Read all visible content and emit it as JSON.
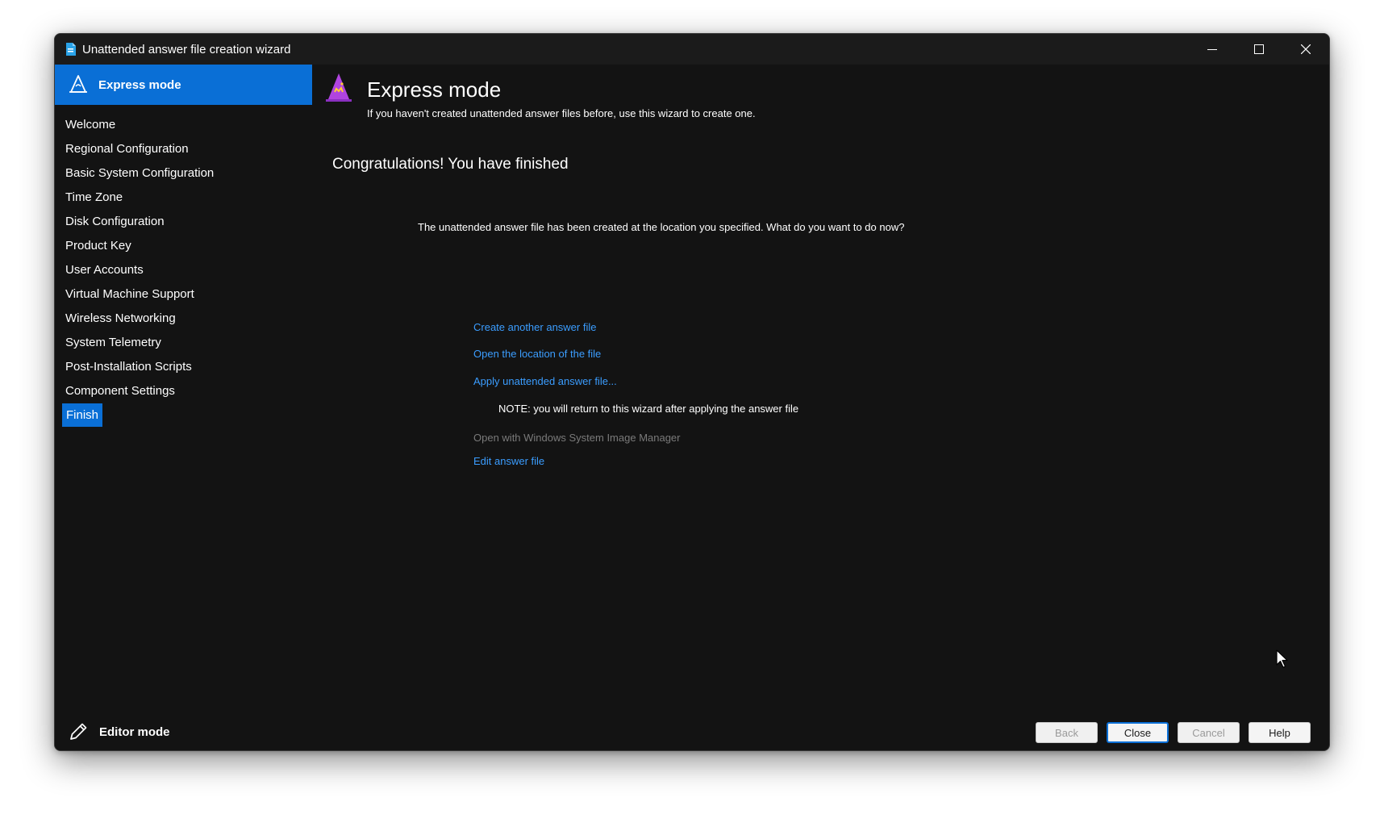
{
  "window": {
    "title": "Unattended answer file creation wizard"
  },
  "sidebar": {
    "header_label": "Express mode",
    "items": [
      {
        "label": "Welcome"
      },
      {
        "label": "Regional Configuration"
      },
      {
        "label": "Basic System Configuration"
      },
      {
        "label": "Time Zone"
      },
      {
        "label": "Disk Configuration"
      },
      {
        "label": "Product Key"
      },
      {
        "label": "User Accounts"
      },
      {
        "label": "Virtual Machine Support"
      },
      {
        "label": "Wireless Networking"
      },
      {
        "label": "System Telemetry"
      },
      {
        "label": "Post-Installation Scripts"
      },
      {
        "label": "Component Settings"
      },
      {
        "label": "Finish"
      }
    ],
    "active_item": "Finish",
    "editor_mode_label": "Editor mode"
  },
  "main": {
    "title": "Express mode",
    "subtitle": "If you haven't created unattended answer files before, use this wizard to create one.",
    "heading": "Congratulations! You have finished",
    "description": "The unattended answer file has been created at the location you specified. What do you want to do now?",
    "links": {
      "create_another": "Create another answer file",
      "open_location": "Open the location of the file",
      "apply": "Apply unattended answer file...",
      "note": "NOTE: you will return to this wizard after applying the answer file",
      "open_wsim": "Open with Windows System Image Manager",
      "edit": "Edit answer file"
    }
  },
  "buttons": {
    "back": "Back",
    "close": "Close",
    "cancel": "Cancel",
    "help": "Help"
  },
  "colors": {
    "accent": "#0a6fd6",
    "link": "#3b9dff",
    "background": "#131313",
    "icon_wizard": "#b044e0"
  },
  "icons": {
    "title": "document-icon",
    "express": "wizard-hat-icon",
    "page": "wizard-hat-icon",
    "editor": "pencil-icon"
  }
}
